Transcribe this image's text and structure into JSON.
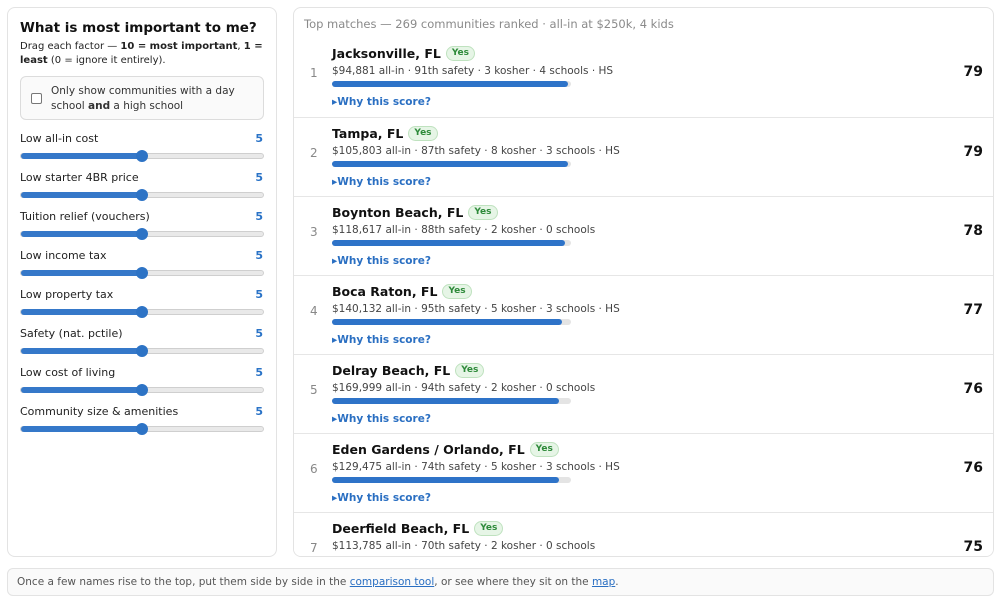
{
  "settings": {
    "title": "What is most important to me?",
    "instructions_prefix": "Drag each factor — ",
    "instructions_bold1": "10 = most important",
    "instructions_mid": ", ",
    "instructions_bold2": "1 = least",
    "instructions_suffix": " (0 = ignore it entirely).",
    "filter_text_prefix": "Only show communities with a day school ",
    "filter_text_bold": "and",
    "filter_text_suffix": " a high school",
    "filter_checked": false,
    "max_value": 10,
    "factors": [
      {
        "label": "Low all-in cost",
        "value": 5
      },
      {
        "label": "Low starter 4BR price",
        "value": 5
      },
      {
        "label": "Tuition relief (vouchers)",
        "value": 5
      },
      {
        "label": "Low income tax",
        "value": 5
      },
      {
        "label": "Low property tax",
        "value": 5
      },
      {
        "label": "Safety (nat. pctile)",
        "value": 5
      },
      {
        "label": "Low cost of living",
        "value": 5
      },
      {
        "label": "Community size & amenities",
        "value": 5
      }
    ]
  },
  "results": {
    "header": "Top matches — 269 communities ranked · all-in at $250k, 4 kids",
    "why_label": "▸Why this score?",
    "items": [
      {
        "rank": "1",
        "name": "Jacksonville, FL",
        "badge": "Yes",
        "meta": "$94,881 all-in · 91th safety · 3 kosher · 4 schools · HS",
        "score": 79
      },
      {
        "rank": "2",
        "name": "Tampa, FL",
        "badge": "Yes",
        "meta": "$105,803 all-in · 87th safety · 8 kosher · 3 schools · HS",
        "score": 79
      },
      {
        "rank": "3",
        "name": "Boynton Beach, FL",
        "badge": "Yes",
        "meta": "$118,617 all-in · 88th safety · 2 kosher · 0 schools",
        "score": 78
      },
      {
        "rank": "4",
        "name": "Boca Raton, FL",
        "badge": "Yes",
        "meta": "$140,132 all-in · 95th safety · 5 kosher · 3 schools · HS",
        "score": 77
      },
      {
        "rank": "5",
        "name": "Delray Beach, FL",
        "badge": "Yes",
        "meta": "$169,999 all-in · 94th safety · 2 kosher · 0 schools",
        "score": 76
      },
      {
        "rank": "6",
        "name": "Eden Gardens / Orlando, FL",
        "badge": "Yes",
        "meta": "$129,475 all-in · 74th safety · 5 kosher · 3 schools · HS",
        "score": 76
      },
      {
        "rank": "7",
        "name": "Deerfield Beach, FL",
        "badge": "Yes",
        "meta": "$113,785 all-in · 70th safety · 2 kosher · 0 schools",
        "score": 75
      }
    ]
  },
  "footer": {
    "prefix": "Once a few names rise to the top, put them side by side in the ",
    "link1": "comparison tool",
    "middle": ", or see where they sit on the ",
    "link2": "map",
    "suffix": "."
  },
  "colors": {
    "accent": "#2e73c8",
    "badge_green": "#2e8a3a"
  }
}
